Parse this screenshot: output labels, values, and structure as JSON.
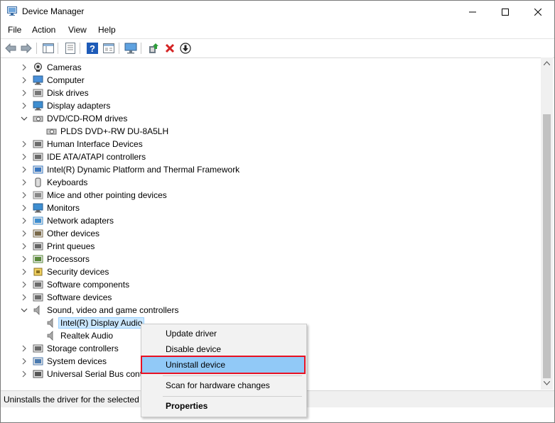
{
  "window": {
    "title": "Device Manager",
    "buttons": [
      "minimize",
      "maximize",
      "close"
    ]
  },
  "menu": [
    "File",
    "Action",
    "View",
    "Help"
  ],
  "toolbar": [
    "back-arrow-icon",
    "forward-arrow-icon",
    "console-tree-icon",
    "properties-icon",
    "help-icon",
    "view-icon",
    "monitor-icon",
    "update-driver-icon",
    "uninstall-icon",
    "download-icon"
  ],
  "tree": [
    {
      "label": "Cameras",
      "expanded": false,
      "icon": "camera-icon"
    },
    {
      "label": "Computer",
      "expanded": false,
      "icon": "computer-icon"
    },
    {
      "label": "Disk drives",
      "expanded": false,
      "icon": "disk-icon"
    },
    {
      "label": "Display adapters",
      "expanded": false,
      "icon": "display-icon"
    },
    {
      "label": "DVD/CD-ROM drives",
      "expanded": true,
      "icon": "dvd-icon"
    },
    {
      "label": "PLDS DVD+-RW DU-8A5LH",
      "child": true,
      "icon": "dvd-icon"
    },
    {
      "label": "Human Interface Devices",
      "expanded": false,
      "icon": "hid-icon"
    },
    {
      "label": "IDE ATA/ATAPI controllers",
      "expanded": false,
      "icon": "ide-icon"
    },
    {
      "label": "Intel(R) Dynamic Platform and Thermal Framework",
      "expanded": false,
      "icon": "chip-icon"
    },
    {
      "label": "Keyboards",
      "expanded": false,
      "icon": "keyboard-icon"
    },
    {
      "label": "Mice and other pointing devices",
      "expanded": false,
      "icon": "mouse-icon"
    },
    {
      "label": "Monitors",
      "expanded": false,
      "icon": "monitor-icon"
    },
    {
      "label": "Network adapters",
      "expanded": false,
      "icon": "network-icon"
    },
    {
      "label": "Other devices",
      "expanded": false,
      "icon": "other-devices-icon"
    },
    {
      "label": "Print queues",
      "expanded": false,
      "icon": "printer-icon"
    },
    {
      "label": "Processors",
      "expanded": false,
      "icon": "processor-icon"
    },
    {
      "label": "Security devices",
      "expanded": false,
      "icon": "security-icon"
    },
    {
      "label": "Software components",
      "expanded": false,
      "icon": "component-icon"
    },
    {
      "label": "Software devices",
      "expanded": false,
      "icon": "software-icon"
    },
    {
      "label": "Sound, video and game controllers",
      "expanded": true,
      "icon": "speaker-icon"
    },
    {
      "label": "Intel(R) Display Audio",
      "child": true,
      "selected": true,
      "icon": "speaker-icon"
    },
    {
      "label": "Realtek Audio",
      "child": true,
      "icon": "speaker-icon"
    },
    {
      "label": "Storage controllers",
      "expanded": false,
      "icon": "storage-icon"
    },
    {
      "label": "System devices",
      "expanded": false,
      "icon": "system-icon"
    },
    {
      "label": "Universal Serial Bus contr",
      "expanded": false,
      "icon": "usb-icon"
    }
  ],
  "context_menu": [
    {
      "label": "Update driver"
    },
    {
      "label": "Disable device"
    },
    {
      "label": "Uninstall device",
      "highlighted": true
    },
    {
      "label": "Scan for hardware changes"
    },
    {
      "label": "Properties",
      "bold": true
    }
  ],
  "status": {
    "text": "Uninstalls the driver for the selected d"
  },
  "colors": {
    "selection_bg": "#cce8ff",
    "menu_highlight": "#91c9f7",
    "annotation_outline": "#e81123"
  }
}
